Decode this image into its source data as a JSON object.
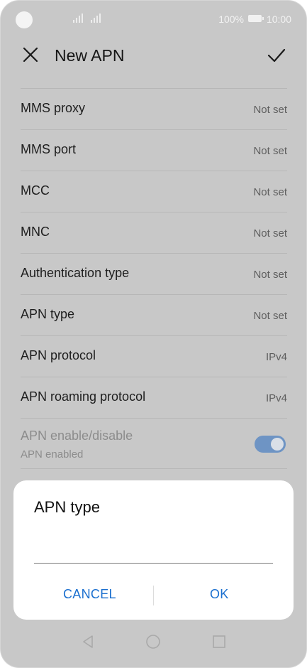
{
  "status_bar": {
    "battery_percent": "100%",
    "time": "10:00"
  },
  "header": {
    "title": "New APN"
  },
  "settings": {
    "rows": [
      {
        "label": "MMS proxy",
        "value": "Not set"
      },
      {
        "label": "MMS port",
        "value": "Not set"
      },
      {
        "label": "MCC",
        "value": "Not set"
      },
      {
        "label": "MNC",
        "value": "Not set"
      },
      {
        "label": "Authentication type",
        "value": "Not set"
      },
      {
        "label": "APN type",
        "value": "Not set"
      },
      {
        "label": "APN protocol",
        "value": "IPv4"
      },
      {
        "label": "APN roaming protocol",
        "value": "IPv4"
      }
    ],
    "toggle_row": {
      "label": "APN enable/disable",
      "sub": "APN enabled",
      "state": "on"
    }
  },
  "dialog": {
    "title": "APN type",
    "input_value": "",
    "cancel_label": "CANCEL",
    "ok_label": "OK"
  },
  "colors": {
    "accent": "#1a6fcf",
    "toggle_on": "#6e94c4",
    "dim_background": "#c8c8c8"
  }
}
